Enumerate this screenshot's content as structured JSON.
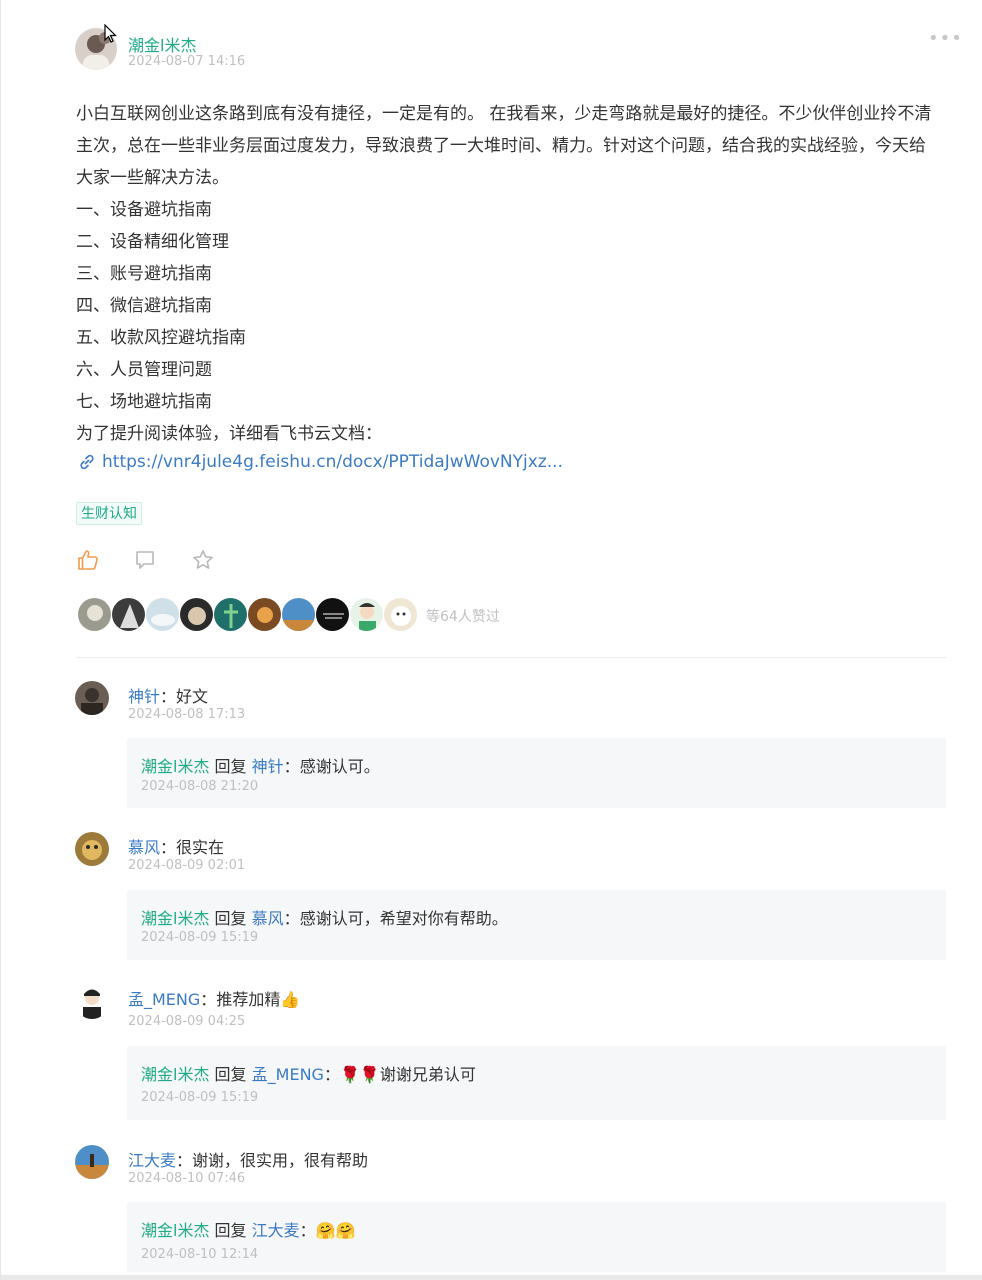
{
  "post": {
    "author": "潮金l米杰",
    "time": "2024-08-07 14:16",
    "more_icon": "more-dots-icon",
    "body_lines": [
      "小白互联网创业这条路到底有没有捷径，一定是有的。 在我看来，少走弯路就是最好的捷径。不少伙伴创业拎不清",
      "主次，总在一些非业务层面过度发力，导致浪费了一大堆时间、精力。针对这个问题，结合我的实战经验，今天给",
      "大家一些解决方法。",
      "一、设备避坑指南",
      "二、设备精细化管理",
      "三、账号避坑指南",
      "四、微信避坑指南",
      "五、收款风控避坑指南",
      "六、人员管理问题",
      "七、场地避坑指南",
      "为了提升阅读体验，详细看飞书云文档："
    ],
    "link_text": "https://vnr4jule4g.feishu.cn/docx/PPTidaJwWovNYjxz...",
    "tag": "生财认知",
    "like_icon": "thumbs-up-icon",
    "comment_icon": "comment-bubble-icon",
    "favorite_icon": "star-icon",
    "accent_color": "#1fab89",
    "link_color": "#3b7bc6",
    "like_summary": "等64人赞过",
    "liker_count_shown": 10
  },
  "comments": [
    {
      "name": "神针",
      "text": "好文",
      "time": "2024-08-08 17:13",
      "reply": {
        "author": "潮金l米杰",
        "verb": "回复",
        "to": "神针",
        "text": "感谢认可。",
        "time": "2024-08-08 21:20"
      }
    },
    {
      "name": "慕风",
      "text": "很实在",
      "time": "2024-08-09 02:01",
      "reply": {
        "author": "潮金l米杰",
        "verb": "回复",
        "to": "慕风",
        "text": "感谢认可，希望对你有帮助。",
        "time": "2024-08-09 15:19"
      }
    },
    {
      "name": "孟_MENG",
      "text": "推荐加精",
      "emoji": "👍",
      "time": "2024-08-09 04:25",
      "reply": {
        "author": "潮金l米杰",
        "verb": "回复",
        "to": "孟_MENG",
        "text": "谢谢兄弟认可",
        "emoji": "🌹🌹",
        "time": "2024-08-09 15:19"
      }
    },
    {
      "name": "江大麦",
      "text": "谢谢，很实用，很有帮助",
      "time": "2024-08-10 07:46",
      "reply": {
        "author": "潮金l米杰",
        "verb": "回复",
        "to": "江大麦",
        "text": "",
        "emoji": "🤗🤗",
        "time": "2024-08-10 12:14"
      }
    }
  ]
}
